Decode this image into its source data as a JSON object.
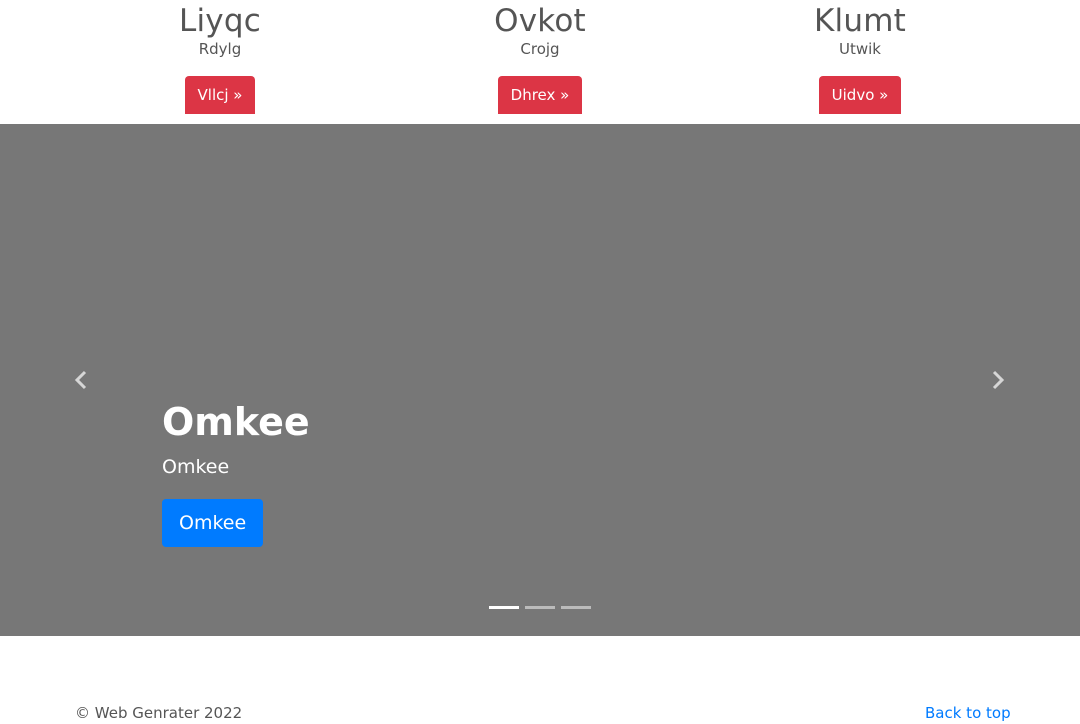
{
  "features": [
    {
      "title": "Liyqc",
      "subtitle": "Rdylg",
      "button_label": "Vllcj »"
    },
    {
      "title": "Ovkot",
      "subtitle": "Crojg",
      "button_label": "Dhrex »"
    },
    {
      "title": "Klumt",
      "subtitle": "Utwik",
      "button_label": "Uidvo »"
    }
  ],
  "carousel": {
    "caption_title": "Omkee",
    "caption_text": "Omkee",
    "caption_button": "Omkee",
    "slide_count": 3,
    "active_slide": 1,
    "background_color": "#777777"
  },
  "footer": {
    "copyright": "© Web Genrater 2022",
    "back_to_top": "Back to top"
  },
  "colors": {
    "danger": "#dc3545",
    "primary": "#007bff"
  }
}
